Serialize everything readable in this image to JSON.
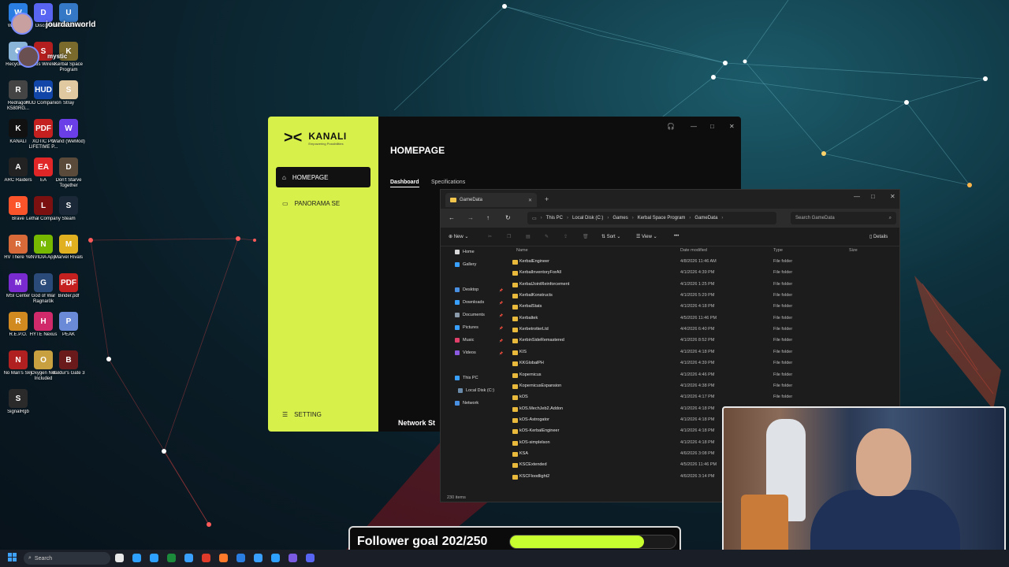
{
  "stream": {
    "user1": "jourdanworld",
    "user2": "mystic"
  },
  "desktop_icons": [
    {
      "label": "Wellbeing",
      "color": "#2a7de1",
      "glyph": "W"
    },
    {
      "label": "Discord",
      "color": "#5865f2",
      "glyph": "D"
    },
    {
      "label": "Ubisoft Connect",
      "color": "#3478c6",
      "glyph": "U"
    },
    {
      "label": "Recycle Bin",
      "color": "#8ab4d8",
      "glyph": "♻"
    },
    {
      "label": "Venus Wirele...",
      "color": "#b31f1f",
      "glyph": "S"
    },
    {
      "label": "Kerbal Space Program",
      "color": "#7a6a2c",
      "glyph": "K"
    },
    {
      "label": "Redragon K580RG...",
      "color": "#444",
      "glyph": "R"
    },
    {
      "label": "HUD Companion",
      "color": "#1146a8",
      "glyph": "HUD"
    },
    {
      "label": "Stray",
      "color": "#e0c8a0",
      "glyph": "S"
    },
    {
      "label": "KANALI",
      "color": "#111",
      "glyph": "K"
    },
    {
      "label": "XOTIC PC LIFETIME P...",
      "color": "#c42020",
      "glyph": "PDF"
    },
    {
      "label": "Wand (WeMod)",
      "color": "#6b3fe8",
      "glyph": "W"
    },
    {
      "label": "ARC Raiders",
      "color": "#222",
      "glyph": "A"
    },
    {
      "label": "EA",
      "color": "#e02626",
      "glyph": "EA"
    },
    {
      "label": "Don't Starve Together",
      "color": "#5a4a3a",
      "glyph": "D"
    },
    {
      "label": "Brave",
      "color": "#fb542b",
      "glyph": "B"
    },
    {
      "label": "Lethal Company",
      "color": "#7a1010",
      "glyph": "L"
    },
    {
      "label": "Steam",
      "color": "#1b2838",
      "glyph": "S"
    },
    {
      "label": "RV There Yet",
      "color": "#d86a3a",
      "glyph": "R"
    },
    {
      "label": "NVIDIA App",
      "color": "#76b900",
      "glyph": "N"
    },
    {
      "label": "Marvel Rivals",
      "color": "#e0b020",
      "glyph": "M"
    },
    {
      "label": "MSI Center",
      "color": "#7a2bd0",
      "glyph": "M"
    },
    {
      "label": "God of War Ragnarök",
      "color": "#2a4a7a",
      "glyph": "G"
    },
    {
      "label": "Binder.pdf",
      "color": "#c42020",
      "glyph": "PDF"
    },
    {
      "label": "R.E.P.O.",
      "color": "#d08a20",
      "glyph": "R"
    },
    {
      "label": "HYTE Nexus",
      "color": "#d02a6a",
      "glyph": "H"
    },
    {
      "label": "PEAK",
      "color": "#6a8ad8",
      "glyph": "P"
    },
    {
      "label": "No Man's Sky",
      "color": "#b02020",
      "glyph": "N"
    },
    {
      "label": "Oxygen Not Included",
      "color": "#c8a040",
      "glyph": "O"
    },
    {
      "label": "Baldur's Gate 3",
      "color": "#6a1a1a",
      "glyph": "B"
    },
    {
      "label": "SignalRgb",
      "color": "#2a2a2a",
      "glyph": "S"
    }
  ],
  "kanali": {
    "brand": "KANALI",
    "tagline": "Empowering Possibilities",
    "nav": [
      "HOMEPAGE",
      "PANORAMA SE"
    ],
    "setting": "SETTING",
    "title": "HOMEPAGE",
    "tabs": [
      "Dashboard",
      "Specifications"
    ],
    "network": "Network St"
  },
  "explorer": {
    "tab_title": "GameData",
    "breadcrumb": [
      "This PC",
      "Local Disk (C:)",
      "Games",
      "Kerbal Space Program",
      "GameData"
    ],
    "search_placeholder": "Search GameData",
    "toolbar": {
      "new": "New",
      "sort": "Sort",
      "view": "View",
      "details": "Details"
    },
    "columns": [
      "Name",
      "Date modified",
      "Type",
      "Size"
    ],
    "nav": [
      "Home",
      "Gallery",
      "Desktop",
      "Downloads",
      "Documents",
      "Pictures",
      "Music",
      "Videos",
      "This PC",
      "Local Disk (C:)",
      "Network"
    ],
    "nav_colors": [
      "#d8d8d8",
      "#3aa0ff",
      "#4a90e2",
      "#3aa0ff",
      "#8a9aaa",
      "#3aa0ff",
      "#e0406a",
      "#8a5ae0",
      "#3aa0ff",
      "#6a8aaa",
      "#4a90e2"
    ],
    "rows": [
      {
        "name": "KerbalEngineer",
        "date": "4/8/2026 11:46 AM",
        "type": "File folder"
      },
      {
        "name": "KerbalInventoryForAll",
        "date": "4/1/2026 4:39 PM",
        "type": "File folder"
      },
      {
        "name": "KerbalJointReinforcement",
        "date": "4/1/2026 1:25 PM",
        "type": "File folder"
      },
      {
        "name": "KerbalKonstructs",
        "date": "4/1/2026 5:29 PM",
        "type": "File folder"
      },
      {
        "name": "KerbalStats",
        "date": "4/1/2026 4:18 PM",
        "type": "File folder"
      },
      {
        "name": "Kerbaltek",
        "date": "4/5/2026 11:46 PM",
        "type": "File folder"
      },
      {
        "name": "KerbetrotterLtd",
        "date": "4/4/2026 6:40 PM",
        "type": "File folder"
      },
      {
        "name": "KerbinSideRemastered",
        "date": "4/1/2026 8:52 PM",
        "type": "File folder"
      },
      {
        "name": "KIS",
        "date": "4/1/2026 4:18 PM",
        "type": "File folder"
      },
      {
        "name": "KKGlobalPH",
        "date": "4/1/2026 4:39 PM",
        "type": "File folder"
      },
      {
        "name": "Kopernicus",
        "date": "4/1/2026 4:46 PM",
        "type": "File folder"
      },
      {
        "name": "KopernicusExpansion",
        "date": "4/1/2026 4:38 PM",
        "type": "File folder"
      },
      {
        "name": "kOS",
        "date": "4/1/2026 4:17 PM",
        "type": "File folder"
      },
      {
        "name": "kOS.MechJeb2.Addon",
        "date": "4/1/2026 4:18 PM",
        "type": "File folder"
      },
      {
        "name": "kOS-Astrogator",
        "date": "4/1/2026 4:18 PM",
        "type": "File folder"
      },
      {
        "name": "kOS-KerbalEngineer",
        "date": "4/1/2026 4:18 PM",
        "type": "File folder"
      },
      {
        "name": "kOS-simplelson",
        "date": "4/1/2026 4:18 PM",
        "type": "File folder"
      },
      {
        "name": "KSA",
        "date": "4/6/2026 3:08 PM",
        "type": "File folder"
      },
      {
        "name": "KSCExtended",
        "date": "4/5/2026 11:46 PM",
        "type": "File folder"
      },
      {
        "name": "KSCFloodlight2",
        "date": "4/6/2026 3:14 PM",
        "type": "File folder"
      }
    ],
    "status": "230 items"
  },
  "goal": {
    "text": "Follower goal 202/250",
    "progress": 0.808
  },
  "taskbar": {
    "search": "Search",
    "apps": [
      "#e8e8e8",
      "#2ea0ff",
      "#2ea0ff",
      "#1b8a3a",
      "#3aa0ff",
      "#e03a2a",
      "#ff7a2a",
      "#2a7de1",
      "#3aa0ff",
      "#2ea0ff",
      "#7a5ae0",
      "#5865f2"
    ]
  }
}
